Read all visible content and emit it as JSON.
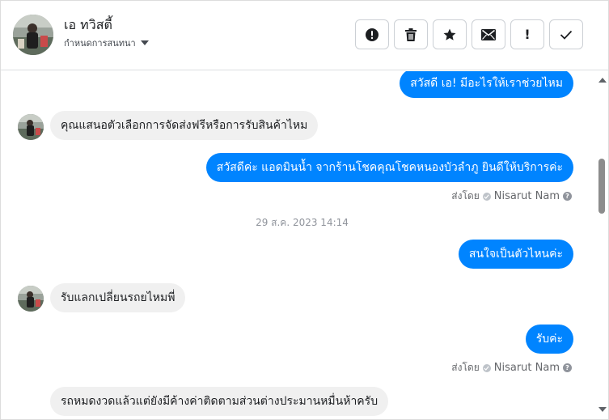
{
  "header": {
    "contact_name": "เอ ทวิสตี้",
    "conversation_status": "กำหนดการสนทนา",
    "toolbar": [
      {
        "name": "spam-button",
        "icon": "alert-circle-icon"
      },
      {
        "name": "delete-button",
        "icon": "trash-icon"
      },
      {
        "name": "star-button",
        "icon": "star-icon"
      },
      {
        "name": "mark-unread-button",
        "icon": "envelope-icon"
      },
      {
        "name": "important-button",
        "icon": "exclamation-icon",
        "glyph": "!"
      },
      {
        "name": "mark-done-button",
        "icon": "checkmark-icon"
      }
    ]
  },
  "conversation": {
    "messages": [
      {
        "direction": "outgoing",
        "text": "สวัสดี เอ! มีอะไรให้เราช่วยไหม"
      },
      {
        "direction": "incoming",
        "text": "คุณแสนอตัวเลือกการจัดส่งฟรีหรือการรับสินค้าไหม"
      },
      {
        "direction": "outgoing",
        "text": "สวัสดีค่ะ แอดมินน้ำ จากร้านโชคคุณโชคหนองบัวลำภู ยินดีให้บริการค่ะ",
        "sent_by_prefix": "ส่งโดย",
        "sender": "Nisarut Nam"
      },
      {
        "direction": "timestamp",
        "text": "29 ส.ค. 2023 14:14"
      },
      {
        "direction": "outgoing",
        "text": "สนใจเป็นตัวไหนค่ะ"
      },
      {
        "direction": "incoming",
        "text": "รับแลกเปลี่ยนรถยไหมพี่"
      },
      {
        "direction": "outgoing",
        "text": "รับค่ะ",
        "sent_by_prefix": "ส่งโดย",
        "sender": "Nisarut Nam"
      },
      {
        "direction": "incoming",
        "text": "รถหมดงวดแล้วแต่ยังมีค้างค่าติดตามส่วนต่างประมานหมื่นห้าครับ"
      }
    ]
  },
  "colors": {
    "outgoing_bubble": "#0084ff",
    "incoming_bubble": "#f0f0f0",
    "meta_text": "#65676b",
    "timestamp_text": "#90949c"
  }
}
